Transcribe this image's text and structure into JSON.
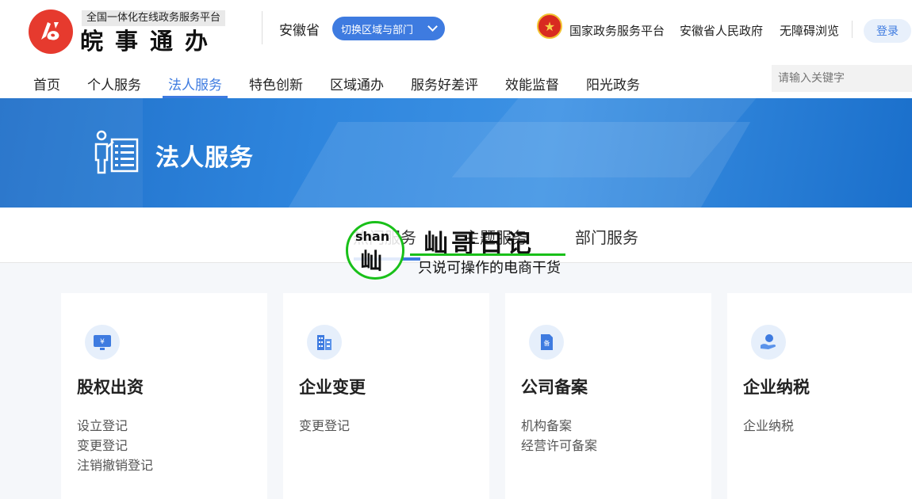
{
  "header": {
    "logo_subtitle": "全国一体化在线政务服务平台",
    "logo_title": "皖事通办",
    "province": "安徽省",
    "switch_label": "切换区域与部门",
    "links": [
      "国家政务服务平台",
      "安徽省人民政府",
      "无障碍浏览"
    ],
    "login_label": "登录"
  },
  "nav": {
    "items": [
      "首页",
      "个人服务",
      "法人服务",
      "特色创新",
      "区域通办",
      "服务好差评",
      "效能监督",
      "阳光政务"
    ],
    "active": "法人服务",
    "search_placeholder": "请输入关键字"
  },
  "banner": {
    "title": "法人服务"
  },
  "tabs": {
    "items": [
      "热门服务",
      "主题服务",
      "部门服务"
    ],
    "active": "热门服务"
  },
  "watermark": {
    "logo_small": "shan",
    "logo_big": "屾",
    "title": "屾哥日记",
    "subtitle": "只说可操作的电商干货"
  },
  "cards": [
    {
      "title": "股权出资",
      "icon": "monitor-yen-icon",
      "links": [
        "设立登记",
        "变更登记",
        "注销撤销登记"
      ]
    },
    {
      "title": "企业变更",
      "icon": "building-icon",
      "links": [
        "变更登记"
      ]
    },
    {
      "title": "公司备案",
      "icon": "document-record-icon",
      "links": [
        "机构备案",
        "经营许可备案"
      ]
    },
    {
      "title": "企业纳税",
      "icon": "hand-tax-icon",
      "links": [
        "企业纳税"
      ]
    }
  ],
  "colors": {
    "accent": "#3e7be0",
    "logo_red": "#e63a2e",
    "banner_blue": "#2f86de"
  }
}
